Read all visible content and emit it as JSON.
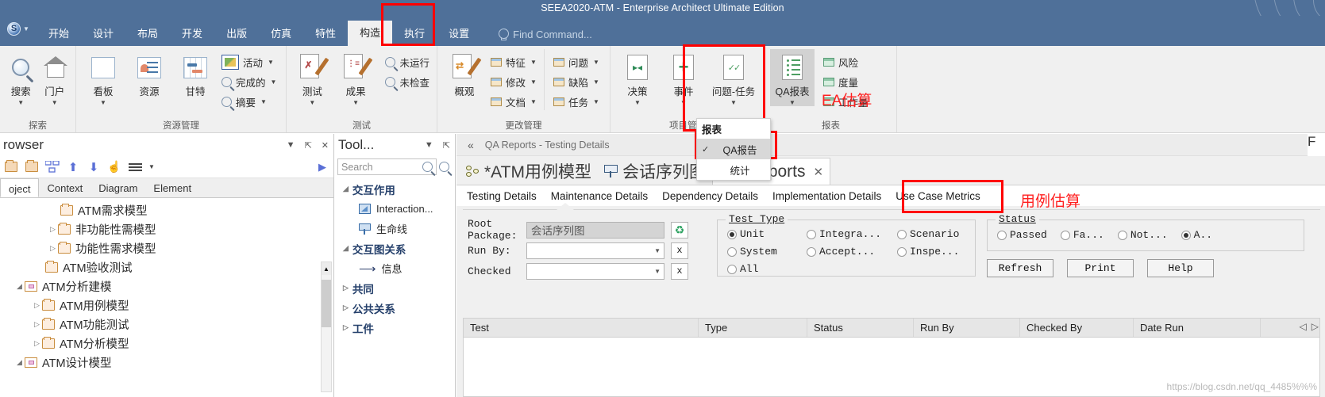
{
  "window": {
    "title": "SEEA2020-ATM - Enterprise Architect Ultimate Edition"
  },
  "ribbon": {
    "tabs": [
      {
        "label": "开始",
        "active": false
      },
      {
        "label": "设计",
        "active": false
      },
      {
        "label": "布局",
        "active": false
      },
      {
        "label": "开发",
        "active": false
      },
      {
        "label": "出版",
        "active": false
      },
      {
        "label": "仿真",
        "active": false
      },
      {
        "label": "特性",
        "active": false
      },
      {
        "label": "构造",
        "active": true
      },
      {
        "label": "执行",
        "active": false
      },
      {
        "label": "设置",
        "active": false
      }
    ],
    "find_command_placeholder": "Find Command...",
    "groups": [
      {
        "title": "探索",
        "big_buttons": [
          {
            "label": "搜索",
            "icon": "magnifier-icon",
            "caret": true
          },
          {
            "label": "门户",
            "icon": "home-icon",
            "caret": true
          }
        ],
        "small_buttons": []
      },
      {
        "title": "资源管理",
        "big_buttons": [
          {
            "label": "看板",
            "icon": "kanban-icon",
            "caret": true
          },
          {
            "label": "资源",
            "icon": "resource-icon",
            "caret": false
          },
          {
            "label": "甘特",
            "icon": "gantt-icon",
            "caret": false
          }
        ],
        "small_buttons": [
          {
            "label": "活动",
            "icon": "activity-icon",
            "caret": true
          },
          {
            "label": "完成的",
            "icon": "magnifier-small-icon",
            "caret": true
          },
          {
            "label": "摘要",
            "icon": "magnifier-small-icon",
            "caret": true
          }
        ]
      },
      {
        "title": "测试",
        "big_buttons": [
          {
            "label": "测试",
            "icon": "test-doc-icon",
            "caret": true
          },
          {
            "label": "成果",
            "icon": "result-doc-icon",
            "caret": true
          }
        ],
        "small_buttons": [
          {
            "label": "未运行",
            "icon": "magnifier-small-icon",
            "caret": false
          },
          {
            "label": "未检查",
            "icon": "magnifier-small-icon",
            "caret": false
          }
        ]
      },
      {
        "title": "更改管理",
        "big_buttons": [
          {
            "label": "概观",
            "icon": "overview-doc-icon",
            "caret": false
          }
        ],
        "small_buttons": [
          {
            "label": "特征",
            "icon": "window-icon",
            "caret": true
          },
          {
            "label": "修改",
            "icon": "window-icon",
            "caret": true
          },
          {
            "label": "文档",
            "icon": "window-icon",
            "caret": true
          }
        ],
        "small_buttons2": [
          {
            "label": "问题",
            "icon": "window-icon",
            "caret": true
          },
          {
            "label": "缺陷",
            "icon": "window-icon",
            "caret": true
          },
          {
            "label": "任务",
            "icon": "window-icon",
            "caret": true
          }
        ]
      },
      {
        "title": "项目管理",
        "big_buttons": [
          {
            "label": "决策",
            "icon": "decision-doc-icon",
            "caret": true
          },
          {
            "label": "事件",
            "icon": "event-doc-icon",
            "caret": true
          },
          {
            "label": "问题-任务",
            "icon": "issue-task-doc-icon",
            "caret": true
          }
        ],
        "small_buttons": []
      },
      {
        "title": "报表",
        "big_buttons": [
          {
            "label": "QA报表",
            "icon": "qa-report-icon",
            "caret": true,
            "selected": true
          }
        ],
        "small_buttons": [
          {
            "label": "风险",
            "icon": "window-green-icon",
            "caret": false
          },
          {
            "label": "度量",
            "icon": "window-green-icon",
            "caret": false
          },
          {
            "label": "工作量",
            "icon": "window-green-icon",
            "caret": false
          }
        ]
      }
    ],
    "dropdown": {
      "header": "报表",
      "items": [
        {
          "label": "QA报告",
          "checked": true,
          "selected": true
        },
        {
          "label": "统计",
          "checked": false,
          "selected": false
        }
      ]
    }
  },
  "annotations": [
    {
      "text": "EA估算",
      "color": "#ff2020"
    },
    {
      "text": "用例估算",
      "color": "#ff2020"
    }
  ],
  "browser": {
    "title": "rowser",
    "header_controls": [
      "chevron-down-icon",
      "pin-icon",
      "close-icon"
    ],
    "toolbar_icons": [
      "new-folder-icon",
      "open-folder-icon",
      "model-view-icon",
      "move-up-icon",
      "move-down-icon",
      "select-icon",
      "menu-icon"
    ],
    "tabs": [
      {
        "label": "oject",
        "active": true
      },
      {
        "label": "Context",
        "active": false
      },
      {
        "label": "Diagram",
        "active": false
      },
      {
        "label": "Element",
        "active": false
      }
    ],
    "tree": [
      {
        "label": "ATM需求模型",
        "indent": 2,
        "expander": "",
        "type": "package"
      },
      {
        "label": "非功能性需模型",
        "indent": 2,
        "expander": "▷",
        "type": "package"
      },
      {
        "label": "功能性需求模型",
        "indent": 2,
        "expander": "▷",
        "type": "package"
      },
      {
        "label": "ATM验收测试",
        "indent": 1,
        "expander": "",
        "type": "package"
      },
      {
        "label": "ATM分析建模",
        "indent": 0,
        "expander": "◢",
        "type": "model"
      },
      {
        "label": "ATM用例模型",
        "indent": 1,
        "expander": "▷",
        "type": "package"
      },
      {
        "label": "ATM功能测试",
        "indent": 1,
        "expander": "▷",
        "type": "package"
      },
      {
        "label": "ATM分析模型",
        "indent": 1,
        "expander": "▷",
        "type": "package"
      },
      {
        "label": "ATM设计模型",
        "indent": 0,
        "expander": "◢",
        "type": "model"
      }
    ]
  },
  "toolbox": {
    "title": "Tool...",
    "search_placeholder": "Search",
    "groups": [
      {
        "label": "交互作用",
        "expanded": true,
        "items": [
          {
            "label": "Interaction...",
            "icon": "interaction-icon"
          },
          {
            "label": "生命线",
            "icon": "lifeline-icon"
          }
        ]
      },
      {
        "label": "交互图关系",
        "expanded": true,
        "items": [
          {
            "label": "信息",
            "icon": "message-arrow-icon"
          }
        ]
      },
      {
        "label": "共同",
        "expanded": false,
        "items": []
      },
      {
        "label": "公共关系",
        "expanded": false,
        "items": []
      },
      {
        "label": "工件",
        "expanded": false,
        "items": []
      }
    ]
  },
  "main": {
    "caption": "QA Reports - Testing Details",
    "doc_tabs": [
      {
        "label": "*ATM用例模型",
        "icon": "use-case-model-icon",
        "active": false,
        "closable": false
      },
      {
        "label": "会话序列图",
        "icon": "sequence-diagram-icon",
        "active": false,
        "closable": false
      },
      {
        "label": "QA Reports",
        "icon": "",
        "active": true,
        "closable": true
      }
    ],
    "sub_tabs": [
      {
        "label": "Testing Details",
        "active": true
      },
      {
        "label": "Maintenance Details",
        "active": false
      },
      {
        "label": "Dependency Details",
        "active": false
      },
      {
        "label": "Implementation Details",
        "active": false
      },
      {
        "label": "Use Case Metrics",
        "active": false,
        "highlighted": true
      }
    ],
    "form": {
      "root_label": "Root Package:",
      "root_value": "会话序列图",
      "run_by_label": "Run By:",
      "run_by_value": "",
      "checked_label": "Checked",
      "checked_value": "",
      "clear_button": "x",
      "test_type": {
        "legend": "Test Type",
        "options": [
          {
            "label": "Unit",
            "selected": true
          },
          {
            "label": "Integra...",
            "selected": false
          },
          {
            "label": "Scenario",
            "selected": false
          },
          {
            "label": "System",
            "selected": false
          },
          {
            "label": "Accept...",
            "selected": false
          },
          {
            "label": "Inspe...",
            "selected": false
          },
          {
            "label": "All",
            "selected": false
          }
        ]
      },
      "status": {
        "legend": "Status",
        "options": [
          {
            "label": "Passed",
            "selected": false
          },
          {
            "label": "Fa...",
            "selected": false
          },
          {
            "label": "Not...",
            "selected": false
          },
          {
            "label": "A..",
            "selected": true
          }
        ]
      },
      "buttons": [
        {
          "label": "Refresh"
        },
        {
          "label": "Print"
        },
        {
          "label": "Help"
        }
      ]
    },
    "grid": {
      "columns": [
        "Test",
        "Type",
        "Status",
        "Run By",
        "Checked By",
        "Date Run"
      ],
      "rows": []
    }
  },
  "watermark": "https://blog.csdn.net/qq_4485%%%"
}
